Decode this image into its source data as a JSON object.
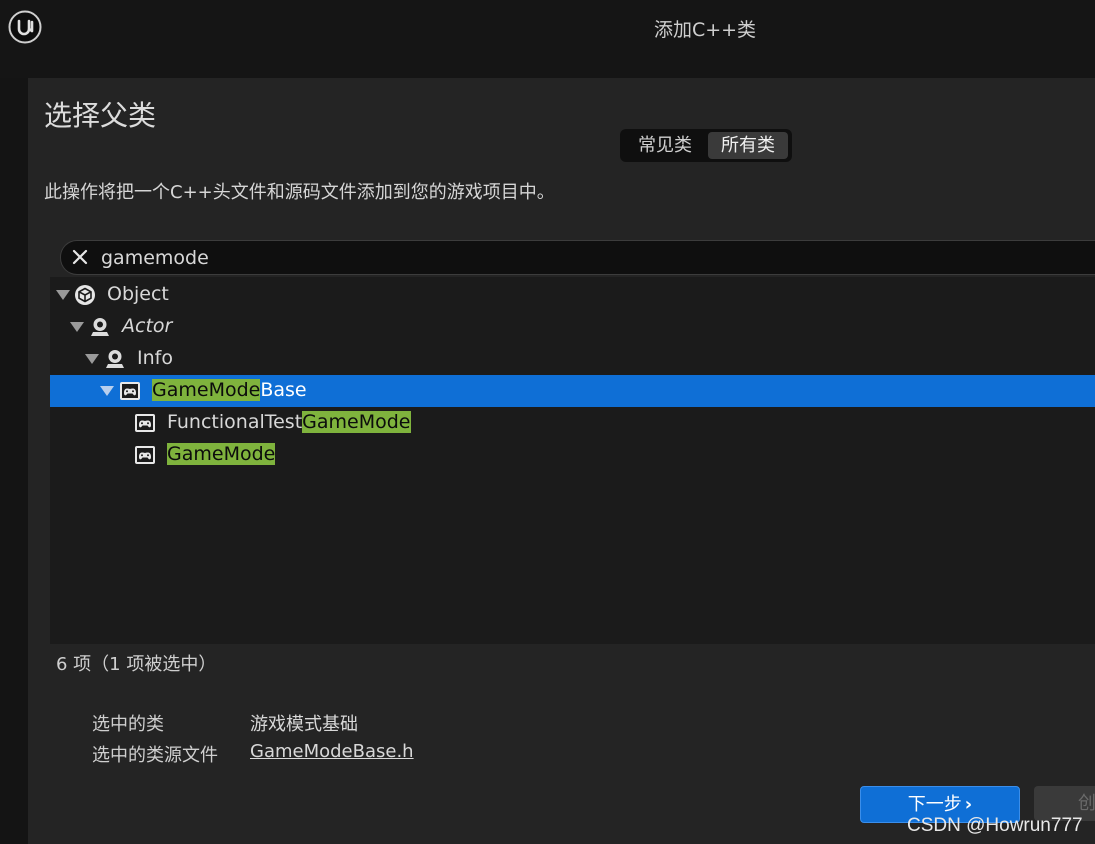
{
  "window": {
    "title": "添加C++类"
  },
  "dialog": {
    "heading": "选择父类",
    "tabs": [
      {
        "label": "常见类",
        "active": false
      },
      {
        "label": "所有类",
        "active": true
      }
    ],
    "description": "此操作将把一个C++头文件和源码文件添加到您的游戏项目中。"
  },
  "search": {
    "value": "gamemode"
  },
  "tree": {
    "object": "Object",
    "actor": "Actor",
    "info": "Info",
    "gamemodebase": {
      "match": "GameMode",
      "rest": "Base",
      "selected": true
    },
    "functionaltest": {
      "prefix": "FunctionalTest",
      "match": "GameMode"
    },
    "gamemode": {
      "match": "GameMode"
    }
  },
  "status": {
    "count": "6 项（1 项被选中）"
  },
  "info": {
    "class_label": "选中的类",
    "class_value": "游戏模式基础",
    "source_label": "选中的类源文件",
    "source_value": "GameModeBase.h"
  },
  "buttons": {
    "next": "下一步",
    "create": "创"
  },
  "watermark": "CSDN @Howrun777",
  "colors": {
    "accent": "#0f6fd6",
    "highlight": "#7fb33d",
    "panel": "#242424"
  },
  "icons": [
    "ue-logo-icon",
    "close-icon",
    "object-class-icon",
    "actor-class-icon",
    "gamemode-class-icon",
    "chevron-right-icon",
    "expand-arrow-icon"
  ]
}
